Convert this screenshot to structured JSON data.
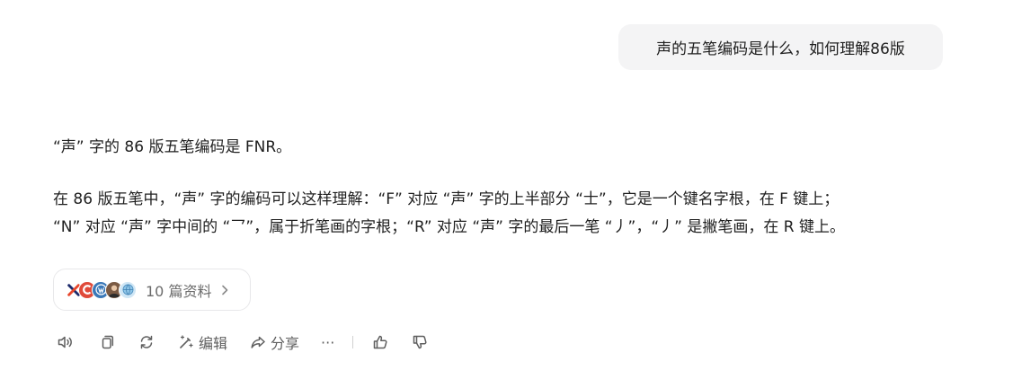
{
  "user_message": "声的五笔编码是什么，如何理解86版",
  "answer": {
    "paragraph1": "“声” 字的 86 版五笔编码是 FNR。",
    "paragraph2_line1": "在 86 版五笔中，“声” 字的编码可以这样理解：“F” 对应 “声” 字的上半部分 “士”，它是一个键名字根，在 F 键上；",
    "paragraph2_line2": "“N” 对应 “声” 字中间的 “乛”，属于折笔画的字根；“R” 对应 “声” 字的最后一笔 “丿”，“丿” 是撇笔画，在 R 键上。"
  },
  "sources": {
    "label": "10 篇资料",
    "icons": [
      "x-logo-icon",
      "c-logo-icon",
      "wordpress-icon",
      "avatar-icon",
      "globe-icon"
    ]
  },
  "toolbar": {
    "edit_label": "编辑",
    "share_label": "分享",
    "more_label": "···"
  },
  "colors": {
    "bubble_bg": "#f4f4f5",
    "text": "#1f1f1f",
    "muted": "#5f5f5f"
  }
}
